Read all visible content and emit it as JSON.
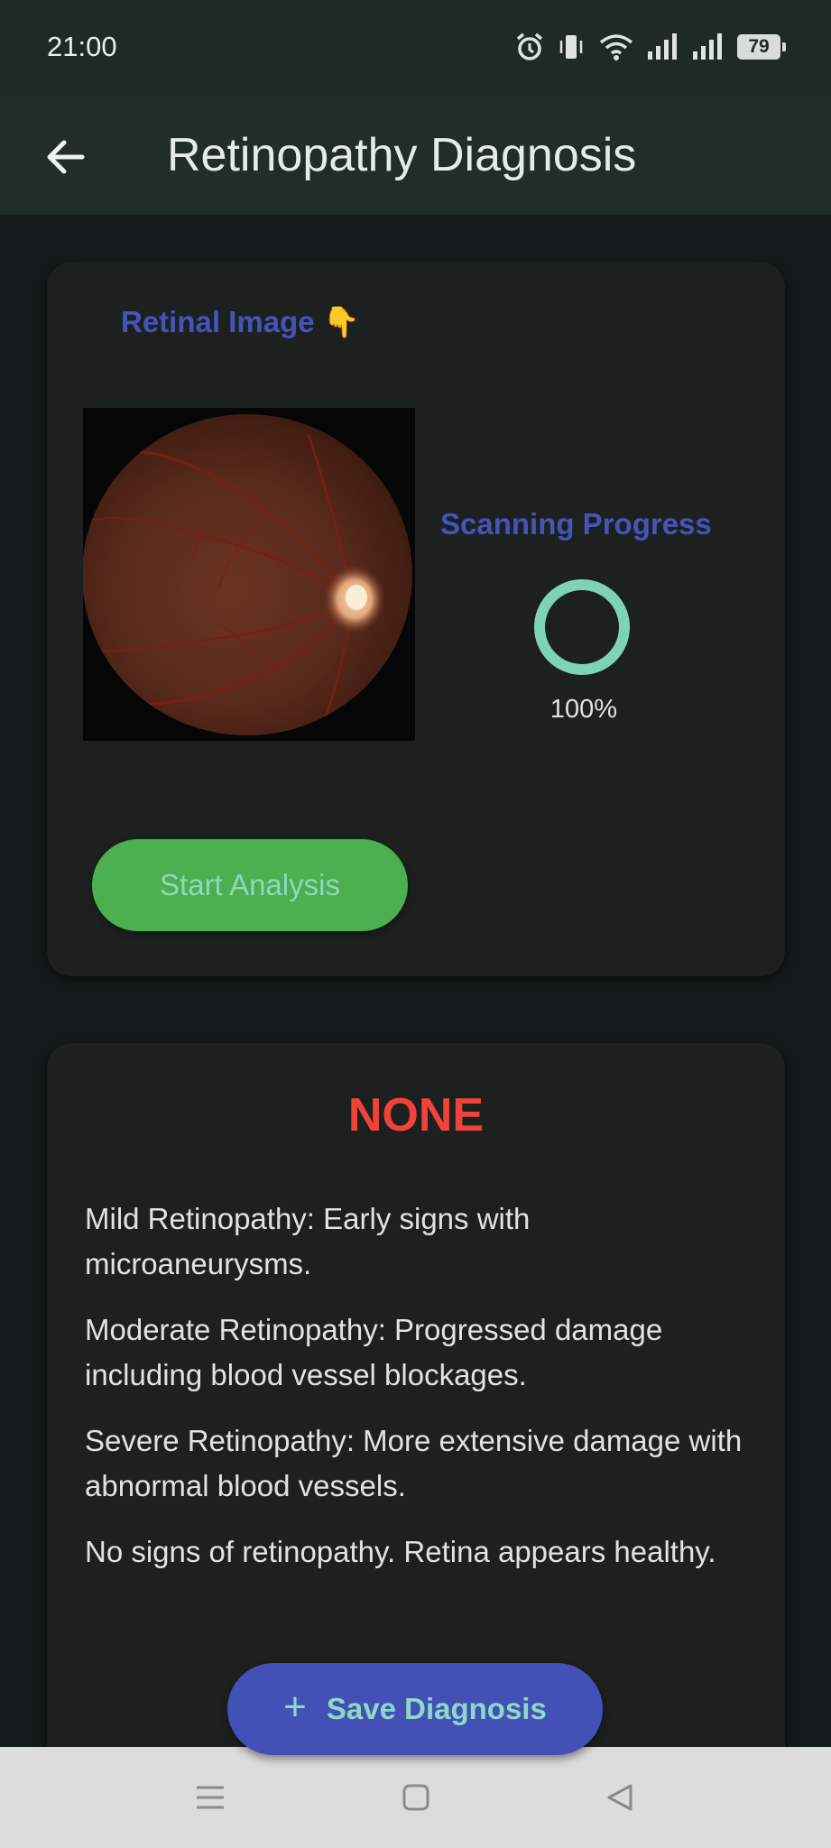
{
  "status_bar": {
    "time": "21:00",
    "battery": "79",
    "icons": [
      "alarm-icon",
      "vibrate-icon",
      "wifi-icon",
      "signal-icon",
      "signal-icon"
    ]
  },
  "app_bar": {
    "title": "Retinopathy Diagnosis",
    "back_icon": "arrow-left-icon"
  },
  "scan_card": {
    "image_label": "Retinal Image",
    "image_label_emoji": "👇",
    "progress_label": "Scanning Progress",
    "progress_value": 1.0,
    "progress_text": "100%",
    "start_button": "Start Analysis"
  },
  "result_card": {
    "result": "NONE",
    "descriptions": [
      "Mild Retinopathy: Early signs with microaneurysms.",
      "Moderate Retinopathy: Progressed damage including blood vessel blockages.",
      "Severe Retinopathy: More extensive damage with abnormal blood vessels.",
      "No signs of retinopathy. Retina appears healthy."
    ]
  },
  "fab": {
    "label": "Save Diagnosis",
    "icon": "plus-icon"
  },
  "nav_bar": {
    "items": [
      "menu-icon",
      "home-icon",
      "back-icon"
    ]
  },
  "colors": {
    "accent_label": "#4653b8",
    "start_button": "#4caf50",
    "result": "#f2433a",
    "progress_ring": "#7fd3b5",
    "fab": "#4350b6"
  }
}
